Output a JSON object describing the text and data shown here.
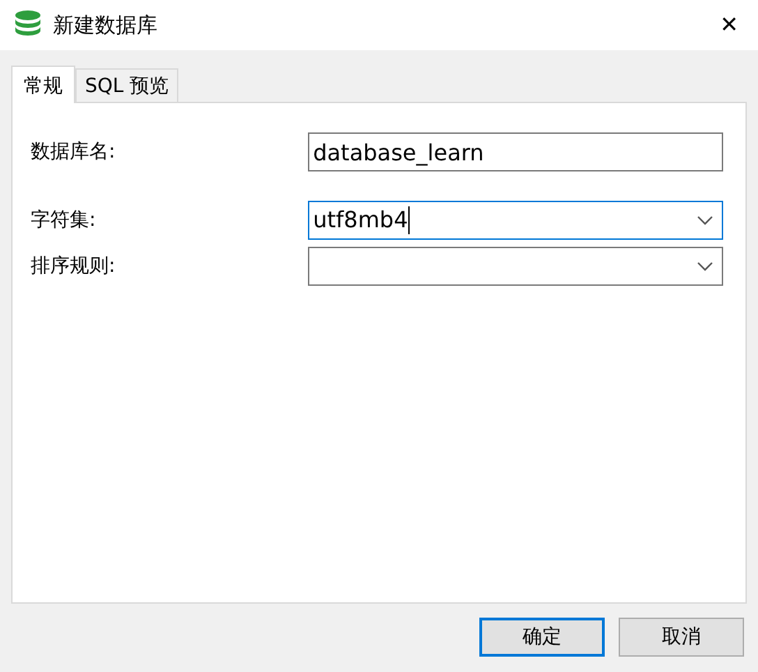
{
  "window": {
    "title": "新建数据库",
    "close": "✕"
  },
  "tabs": [
    {
      "label": "常规",
      "selected": true
    },
    {
      "label": "SQL 预览",
      "selected": false
    }
  ],
  "fields": [
    {
      "label": "数据库名:",
      "kind": "text",
      "value": "database_learn",
      "focused": false
    },
    {
      "label": "字符集:",
      "kind": "select",
      "value": "utf8mb4",
      "focused": true
    },
    {
      "label": "排序规则:",
      "kind": "select",
      "focused": false
    }
  ],
  "buttons": [
    {
      "label": "确定",
      "default": true
    },
    {
      "label": "取消",
      "default": false
    }
  ]
}
